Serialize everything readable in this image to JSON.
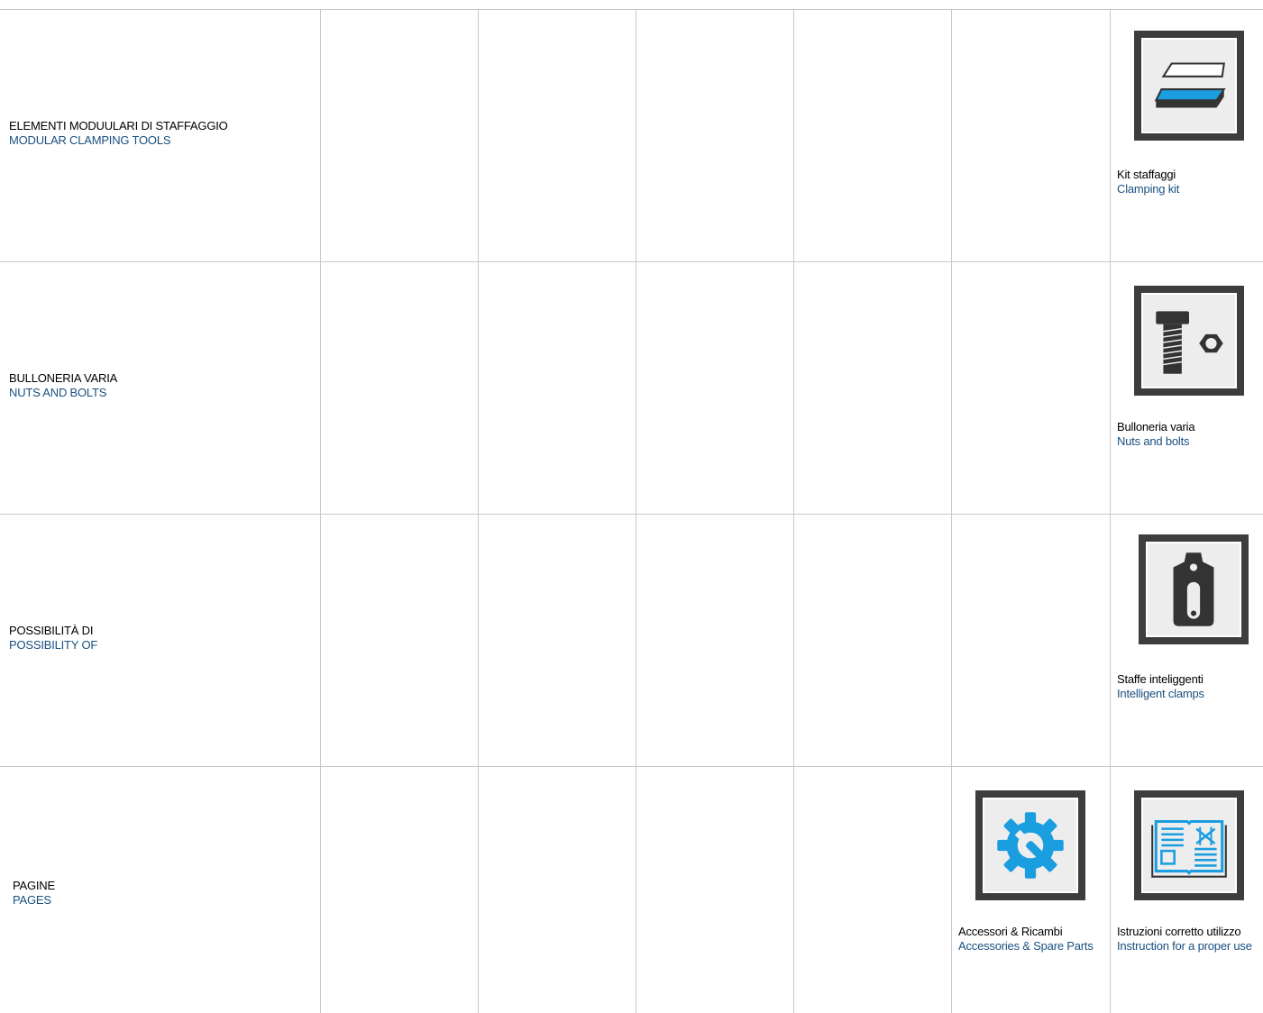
{
  "rows": [
    {
      "label_it": "ELEMENTI MODUULARI DI STAFFAGGIO",
      "label_en": "MODULAR CLAMPING TOOLS",
      "items": [
        {
          "icon": "clamping-kit-icon",
          "label_it": "Kit staffaggi",
          "label_en": "Clamping kit"
        }
      ]
    },
    {
      "label_it": "BULLONERIA VARIA",
      "label_en": "NUTS AND BOLTS",
      "items": [
        {
          "icon": "bolt-nut-icon",
          "label_it": "Bulloneria varia",
          "label_en": "Nuts and bolts"
        }
      ]
    },
    {
      "label_it": "POSSIBILITÀ DI",
      "label_en": "POSSIBILITY OF",
      "items": [
        {
          "icon": "intelligent-clamp-icon",
          "label_it": "Staffe inteliggenti",
          "label_en": "Intelligent clamps"
        }
      ]
    },
    {
      "label_it": "PAGINE",
      "label_en": "PAGES",
      "items": [
        {
          "icon": "gear-wrench-icon",
          "label_it": "Accessori & Ricambi",
          "label_en": "Accessories & Spare Parts"
        },
        {
          "icon": "manual-book-icon",
          "label_it": "Istruzioni corretto utilizzo",
          "label_en": "Instruction for a proper use"
        }
      ]
    }
  ],
  "colors": {
    "accent_blue": "#1a9ee0",
    "label_blue": "#1a5080",
    "icon_frame": "#3d3d3d",
    "grid_line": "#c8c8c8"
  }
}
